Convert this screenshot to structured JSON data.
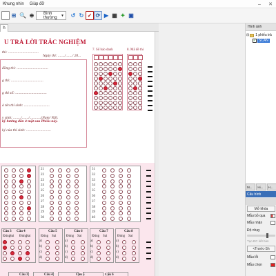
{
  "menu": {
    "items": [
      "Khung nhìn",
      "Giúp đỡ"
    ]
  },
  "toolbar": {
    "zoom_select": "Bình thường",
    "zoom_small_value": ""
  },
  "tab": {
    "label": "h"
  },
  "sheet": {
    "title": "U TRẢ LỜI TRẮC NGHIỆM",
    "line_thi": "thi: ................................",
    "line_ngay": "Ngày thi: ......./......./ 20...",
    "line_dong_thi": "đồng thi: .................................",
    "line_thi2": "g thi: ..................................",
    "line_thi_so": "g thi số: .................................",
    "line_ten": "à tên thí sinh: ...........................",
    "line_ngay_sinh": "y sinh: ......../......./............(Nam/ Nữ).",
    "line_thi_sinh": "ký của thí sinh: ..........................",
    "instruction": "kỹ hướng dẫn ở mặt sau Phiếu này.",
    "sbd_label": "7. Số báo danh",
    "made_label": "8. Mã đề thi",
    "part2_heads": [
      "Câu 3",
      "Câu 4",
      "Câu 5",
      "Câu 6",
      "Câu 7",
      "Câu 8"
    ],
    "dung": "Đúng",
    "sai": "Sai",
    "part3_heads": [
      "Câu 3",
      "Câu 4",
      "Câu 5",
      "Câu 6"
    ],
    "rows_left": [
      "1",
      "2",
      "3"
    ],
    "nums_col2": [
      "21",
      "22",
      "23",
      "24",
      "25",
      "26",
      "27",
      "28",
      "29",
      "30"
    ],
    "nums_col3": [
      "31",
      "32",
      "33",
      "34",
      "35",
      "36",
      "37",
      "38",
      "39",
      "40"
    ],
    "abcd": [
      "a)",
      "b)",
      "c)",
      "d)"
    ]
  },
  "right_panel": {
    "header": "Hình ảnh",
    "tree_root": "1 phiếu trả",
    "tree_item": "SCAN",
    "tabs": [
      "M...",
      "Hi...",
      "H..."
    ],
    "title": "Cấu hình",
    "btn_open": "Mở khóa",
    "label_bo_qua": "Mẫu bỏ qua",
    "label_nhan": "Mẫu nhận",
    "label_do_nhay": "Độ nhạy",
    "gray_text": "Tạo ĐC kết bản",
    "btn_prev": "<Trước-Sh",
    "label_loi": "Mẫu lỗi",
    "label_chon": "Mẫu chọn"
  },
  "colors": {
    "accent_red": "#c0203a",
    "bubble_fill": "#d8283a",
    "panel_blue": "#3a6fb8",
    "swatch_loi": "#ffffff",
    "swatch_chon": "#e02020"
  }
}
